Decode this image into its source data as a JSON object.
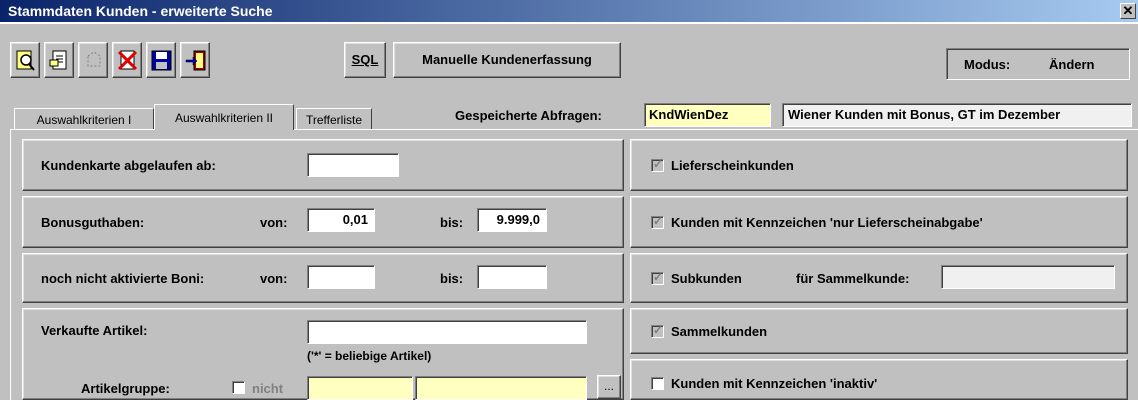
{
  "window": {
    "title": "Stammdaten Kunden - erweiterte Suche",
    "close_glyph": "✕"
  },
  "toolbar": {
    "sql_label": "SQL",
    "manual_label": "Manuelle Kundenerfassung",
    "modus_label": "Modus:",
    "modus_value": "Ändern"
  },
  "tabs": [
    {
      "label": "Auswahlkriterien I"
    },
    {
      "label": "Auswahlkriterien II"
    },
    {
      "label": "Trefferliste"
    }
  ],
  "saved_queries": {
    "label": "Gespeicherte Abfragen:",
    "code": "KndWienDez",
    "description": "Wiener Kunden mit Bonus, GT im Dezember"
  },
  "left": {
    "kundenkarte_label": "Kundenkarte abgelaufen ab:",
    "kundenkarte_value": "",
    "bonus_label": "Bonusguthaben:",
    "bonus_von_label": "von:",
    "bonus_von_value": "0,01",
    "bonus_bis_label": "bis:",
    "bonus_bis_value": "9.999,0",
    "boni_label": "noch nicht aktivierte Boni:",
    "boni_von_label": "von:",
    "boni_von_value": "",
    "boni_bis_label": "bis:",
    "boni_bis_value": "",
    "artikel_label": "Verkaufte Artikel:",
    "artikel_value": "",
    "artikel_hint": "('*' = beliebige Artikel)",
    "artikelgruppe_label": "Artikelgruppe:",
    "nicht_label": "nicht",
    "ellipsis_label": "..."
  },
  "right": {
    "lieferschein_label": "Lieferscheinkunden",
    "nur_lieferschein_label": "Kunden mit Kennzeichen 'nur Lieferscheinabgabe'",
    "subkunden_label": "Subkunden",
    "sammelkunde_field_label": "für Sammelkunde:",
    "sammelkunde_value": "",
    "sammelkunden_label": "Sammelkunden",
    "inaktiv_label": "Kunden mit Kennzeichen 'inaktiv'"
  }
}
